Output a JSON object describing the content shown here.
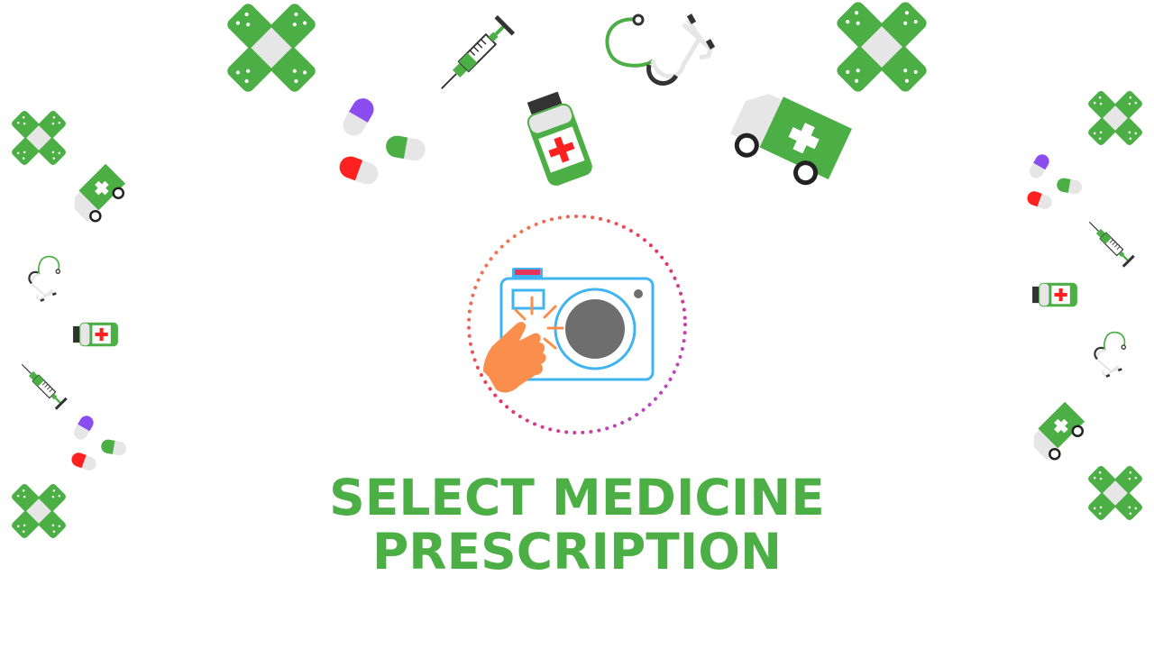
{
  "title": {
    "line1": "SELECT MEDICINE",
    "line2": "PRESCRIPTION"
  },
  "colors": {
    "accent_green": "#4caf46",
    "camera_blue": "#3fb4f0",
    "hand_orange": "#f98e4d",
    "lens_gray": "#6e6e6e",
    "flash_red": "#e8345c",
    "ring_start": "#f98e4d",
    "ring_end": "#a34ee9"
  },
  "icons": {
    "main": "camera-tap-icon",
    "decorations": [
      "bandage-icon",
      "syringe-icon",
      "pill-icon",
      "stethoscope-icon",
      "medicine-bottle-icon",
      "ambulance-icon"
    ]
  }
}
